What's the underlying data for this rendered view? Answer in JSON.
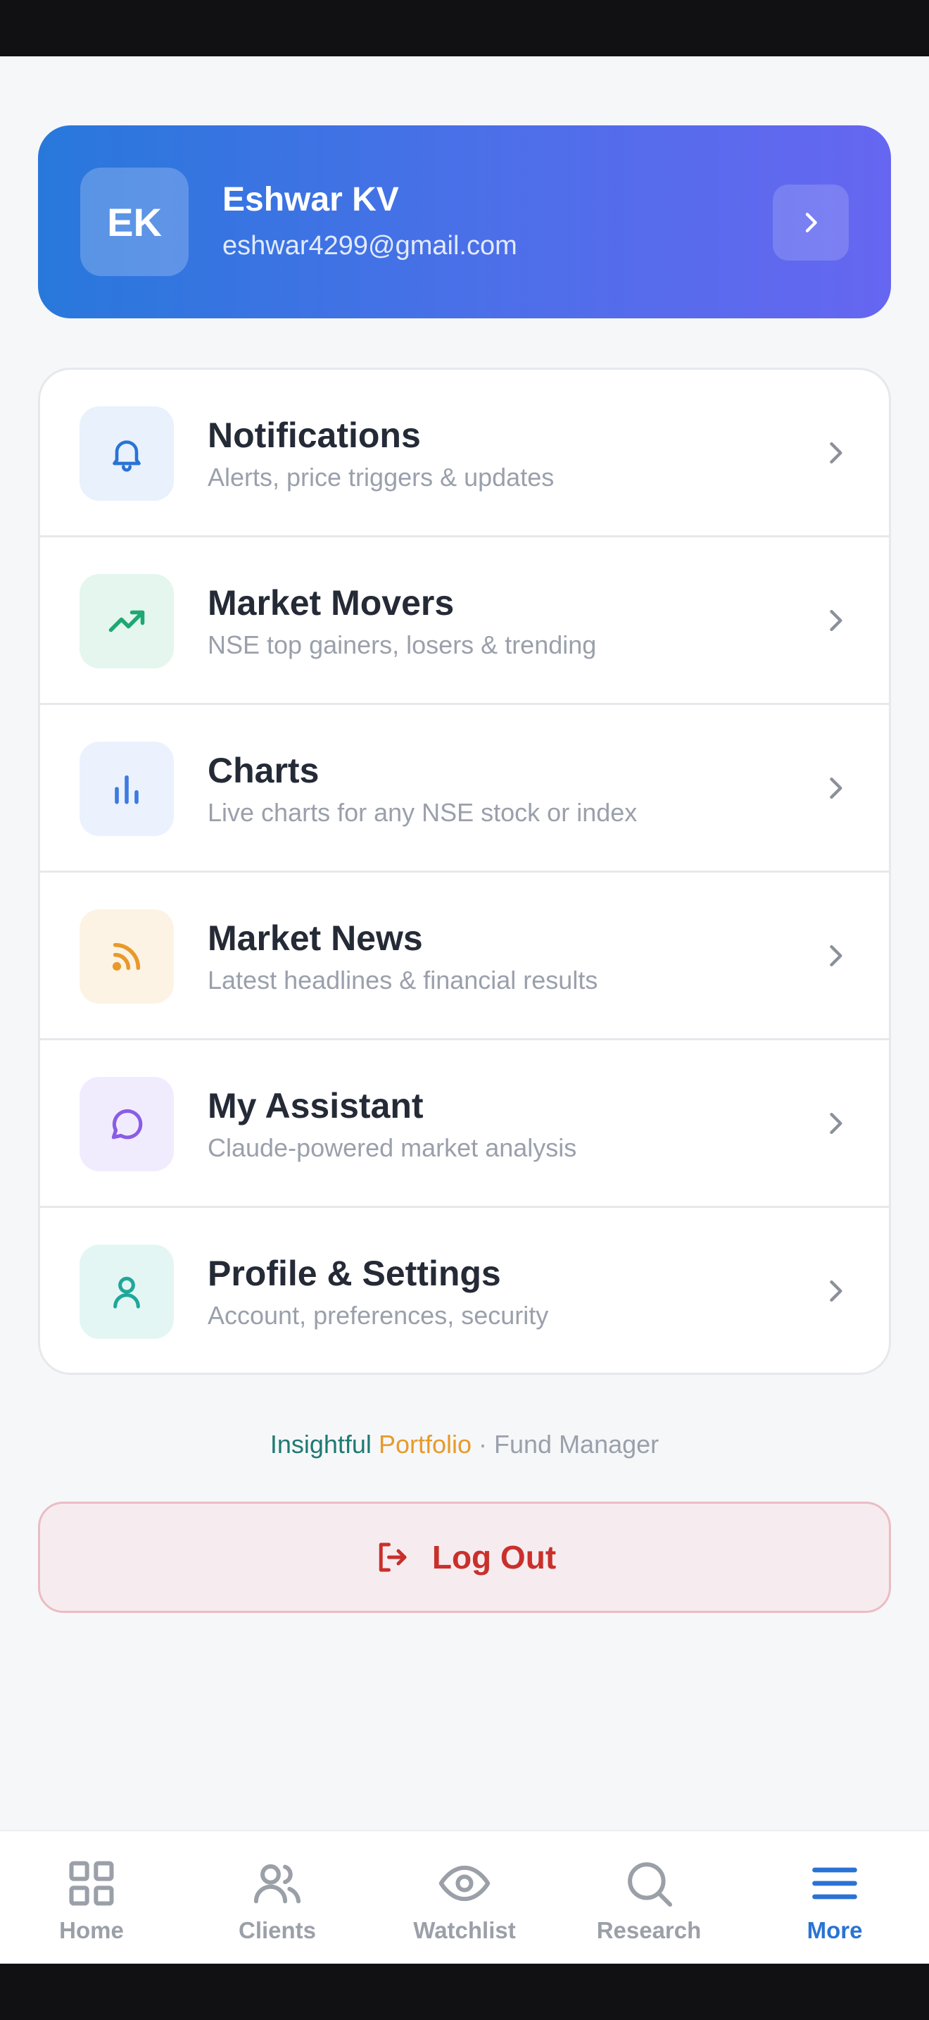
{
  "profile": {
    "initials": "EK",
    "name": "Eshwar KV",
    "email": "eshwar4299@gmail.com"
  },
  "menu": [
    {
      "title": "Notifications",
      "subtitle": "Alerts, price triggers & updates",
      "icon": "bell-icon",
      "color": "#2a73d4",
      "bg": "#e8f1fc"
    },
    {
      "title": "Market Movers",
      "subtitle": "NSE top gainers, losers & trending",
      "icon": "trending-up-icon",
      "color": "#1fa774",
      "bg": "#e4f6ee"
    },
    {
      "title": "Charts",
      "subtitle": "Live charts for any NSE stock or index",
      "icon": "bar-chart-icon",
      "color": "#3d7ae0",
      "bg": "#ebf1fd"
    },
    {
      "title": "Market News",
      "subtitle": "Latest headlines & financial results",
      "icon": "rss-icon",
      "color": "#e79a2a",
      "bg": "#fdf3e4"
    },
    {
      "title": "My Assistant",
      "subtitle": "Claude-powered market analysis",
      "icon": "chat-bubble-icon",
      "color": "#8a5ce6",
      "bg": "#f1ecfd"
    },
    {
      "title": "Profile & Settings",
      "subtitle": "Account, preferences, security",
      "icon": "user-icon",
      "color": "#1fa79a",
      "bg": "#e4f6f3"
    }
  ],
  "footer": {
    "brand_a": "Insightful",
    "brand_b": "Portfolio",
    "suffix": " · Fund Manager"
  },
  "logout": {
    "label": "Log Out",
    "color": "#c9302c"
  },
  "nav": [
    {
      "label": "Home",
      "icon": "grid-icon"
    },
    {
      "label": "Clients",
      "icon": "users-icon"
    },
    {
      "label": "Watchlist",
      "icon": "eye-icon"
    },
    {
      "label": "Research",
      "icon": "search-icon"
    },
    {
      "label": "More",
      "icon": "menu-icon",
      "active": true
    }
  ]
}
